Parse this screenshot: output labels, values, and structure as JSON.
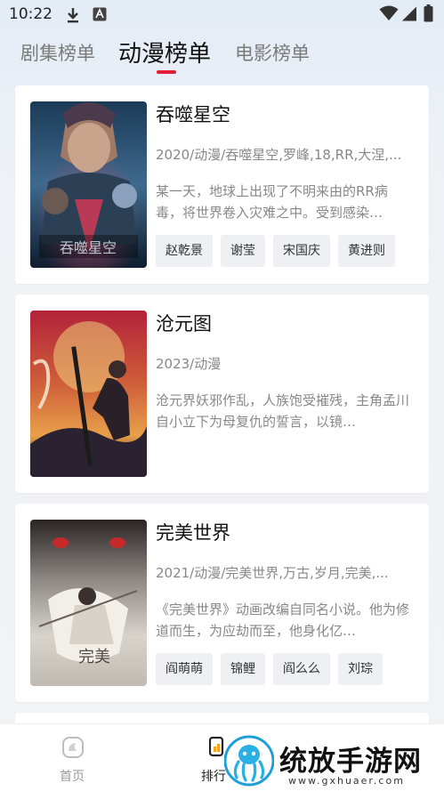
{
  "status_bar": {
    "time": "10:22",
    "left_icons": [
      "download-icon",
      "font-a-icon"
    ],
    "right_icons": [
      "wifi-icon",
      "signal-icon",
      "battery-icon"
    ]
  },
  "tabs": [
    {
      "label": "剧集榜单",
      "active": false
    },
    {
      "label": "动漫榜单",
      "active": true
    },
    {
      "label": "电影榜单",
      "active": false
    }
  ],
  "accent_color": "#e21f36",
  "items": [
    {
      "title": "吞噬星空",
      "meta": "2020/动漫/吞噬星空,罗峰,18,RR,大涅,...",
      "description": "某一天，地球上出现了不明来由的RR病毒，将世界卷入灾难之中。受到感染…",
      "cast": [
        "赵乾景",
        "谢莹",
        "宋国庆",
        "黄进则"
      ]
    },
    {
      "title": "沧元图",
      "meta": "2023/动漫",
      "description": "沧元界妖邪作乱，人族饱受摧残，主角孟川自小立下为母复仇的誓言，以镜…",
      "cast": []
    },
    {
      "title": "完美世界",
      "meta": "2021/动漫/完美世界,万古,岁月,完美,...",
      "description": "《完美世界》动画改编自同名小说。他为修道而生，为应劫而至，他身化亿…",
      "cast": [
        "阎萌萌",
        "锦鲤",
        "阎么么",
        "刘琮"
      ]
    }
  ],
  "bottom_nav": [
    {
      "label": "首页",
      "icon": "home-icon",
      "active": false
    },
    {
      "label": "排行",
      "icon": "ranking-icon",
      "active": true
    }
  ],
  "watermark": {
    "text": "统放手游网",
    "url": "www.gxhuaer.com",
    "logo": "octopus-logo"
  }
}
